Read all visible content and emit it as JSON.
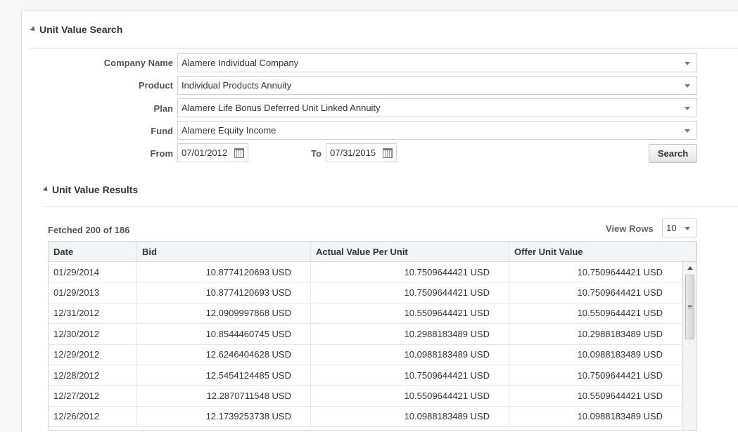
{
  "search": {
    "title": "Unit Value Search",
    "company_label": "Company Name",
    "company_value": "Alamere Individual Company",
    "product_label": "Product",
    "product_value": "Individual Products Annuity",
    "plan_label": "Plan",
    "plan_value": "Alamere Life Bonus Deferred Unit Linked Annuity",
    "fund_label": "Fund",
    "fund_value": "Alamere Equity Income",
    "from_label": "From",
    "from_value": "07/01/2012",
    "to_label": "To",
    "to_value": "07/31/2015",
    "search_button": "Search"
  },
  "results": {
    "title": "Unit Value Results",
    "fetched": "Fetched 200 of 186",
    "view_rows_label": "View Rows",
    "view_rows_value": "10",
    "columns": [
      "Date",
      "Bid",
      "Actual Value Per Unit",
      "Offer Unit Value"
    ],
    "rows": [
      [
        "01/29/2014",
        "10.8774120693 USD",
        "10.7509644421 USD",
        "10.7509644421 USD"
      ],
      [
        "01/29/2013",
        "10.8774120693 USD",
        "10.7509644421 USD",
        "10.7509644421 USD"
      ],
      [
        "12/31/2012",
        "12.0909997868 USD",
        "10.5509644421 USD",
        "10.5509644421 USD"
      ],
      [
        "12/30/2012",
        "10.8544460745 USD",
        "10.2988183489 USD",
        "10.2988183489 USD"
      ],
      [
        "12/29/2012",
        "12.6246404628 USD",
        "10.0988183489 USD",
        "10.0988183489 USD"
      ],
      [
        "12/28/2012",
        "12.5454124485 USD",
        "10.7509644421 USD",
        "10.7509644421 USD"
      ],
      [
        "12/27/2012",
        "12.2870711548 USD",
        "10.5509644421 USD",
        "10.5509644421 USD"
      ],
      [
        "12/26/2012",
        "12.1739253738 USD",
        "10.0988183489 USD",
        "10.0988183489 USD"
      ]
    ]
  }
}
